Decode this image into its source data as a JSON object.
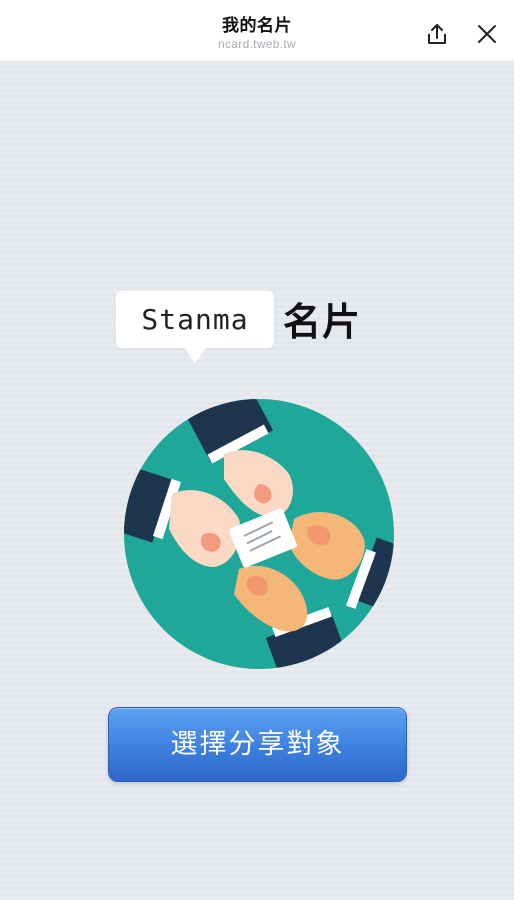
{
  "header": {
    "title": "我的名片",
    "url": "ncard.tweb.tw",
    "share_icon": "share-icon",
    "close_icon": "close-icon"
  },
  "card": {
    "name": "Stanma",
    "suffix": "名片"
  },
  "illustration": {
    "icon": "business-card-exchange-illustration",
    "colors": {
      "circle": "#1fa89a",
      "sleeve": "#1e3550",
      "skin_light": "#fbd9c4",
      "skin_tan": "#f4b777",
      "card": "#ffffff"
    }
  },
  "cta": {
    "label": "選擇分享對象",
    "color": "#3c7fdf"
  }
}
